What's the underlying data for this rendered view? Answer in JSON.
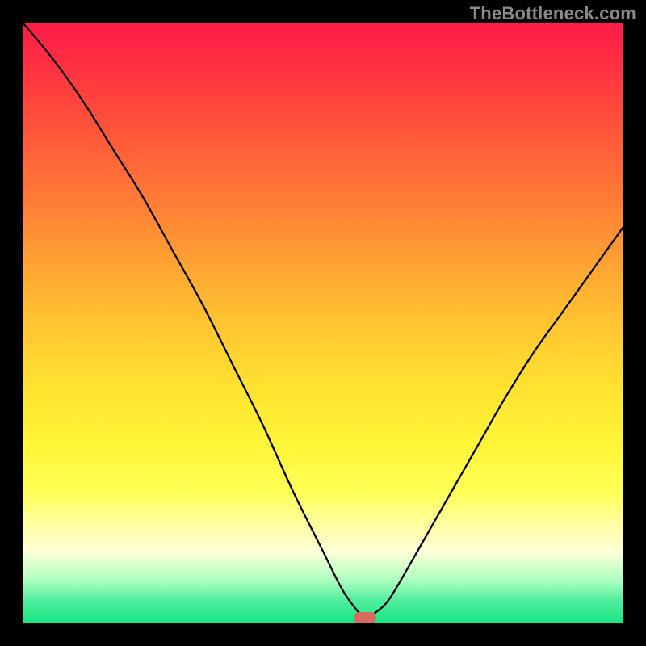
{
  "watermark": "TheBottleneck.com",
  "marker": {
    "x_pct": 57.1,
    "y_ref": "bottom",
    "color": "#d96a62"
  },
  "colors": {
    "frame_bg": "#000000",
    "top": "#ff1a4a",
    "bottom": "#17e683",
    "marker": "#d96a62"
  },
  "chart_data": {
    "type": "line",
    "title": "",
    "xlabel": "",
    "ylabel": "",
    "xlim": [
      0,
      100
    ],
    "ylim": [
      0,
      100
    ],
    "x": [
      0,
      5,
      10,
      15,
      20,
      25,
      30,
      35,
      40,
      45,
      50,
      53,
      55,
      57,
      59,
      61,
      64,
      68,
      72,
      76,
      80,
      85,
      90,
      95,
      100
    ],
    "values": [
      100,
      94,
      87,
      79,
      71,
      62,
      53,
      43,
      33,
      22,
      12,
      6,
      3,
      1,
      2,
      4,
      9,
      16,
      23,
      30,
      37,
      45,
      52,
      59,
      66
    ],
    "annotations": [
      {
        "type": "marker",
        "x": 57,
        "y": 0,
        "label": ""
      }
    ]
  }
}
